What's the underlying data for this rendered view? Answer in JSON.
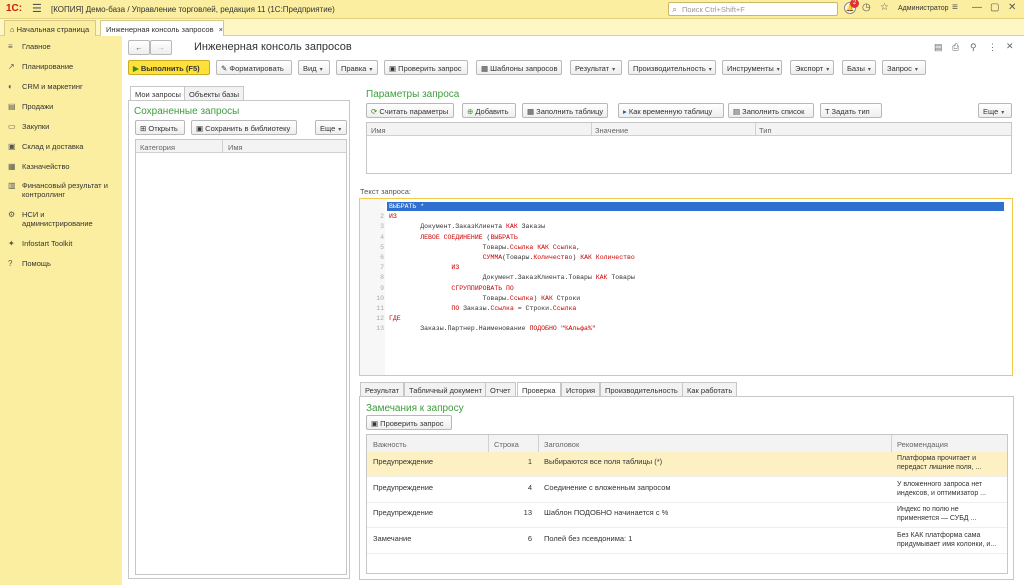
{
  "titlebar": {
    "logo": "1С:",
    "title": "[КОПИЯ] Демо-база / Управление торговлей, редакция 11  (1С:Предприятие)",
    "search_placeholder": "Поиск Ctrl+Shift+F",
    "notif_count": "2",
    "user": "Администратор"
  },
  "tabs": {
    "home": "Начальная страница",
    "console": "Инженерная консоль запросов",
    "close": "×"
  },
  "sidebar": [
    {
      "icon": "≡",
      "label": "Главное"
    },
    {
      "icon": "↗",
      "label": "Планирование"
    },
    {
      "icon": "◐",
      "label": "CRM и маркетинг"
    },
    {
      "icon": "▤",
      "label": "Продажи"
    },
    {
      "icon": "▭",
      "label": "Закупки"
    },
    {
      "icon": "▣",
      "label": "Склад и доставка"
    },
    {
      "icon": "▦",
      "label": "Казначейство"
    },
    {
      "icon": "▥",
      "label": "Финансовый результат и контроллинг"
    },
    {
      "icon": "⚙",
      "label": "НСИ и администрирование"
    },
    {
      "icon": "✦",
      "label": "Infostart Toolkit"
    },
    {
      "icon": "?",
      "label": "Помощь"
    }
  ],
  "page": {
    "title": "Инженерная консоль запросов",
    "back": "←",
    "forward": "→"
  },
  "toolbar": {
    "run": "Выполнить (F5)",
    "format": "Форматировать",
    "vid": "Вид",
    "edit": "Правка",
    "check": "Проверить запрос",
    "templates": "Шаблоны запросов",
    "result": "Результат",
    "perf": "Производительность",
    "tools": "Инструменты",
    "export": "Экспорт",
    "bases": "Базы",
    "query": "Запрос"
  },
  "left": {
    "tab1": "Мои запросы",
    "tab2": "Объекты базы",
    "heading": "Сохраненные запросы",
    "open": "Открыть",
    "save": "Сохранить в библиотеку",
    "more": "Еще",
    "col1": "Категория",
    "col2": "Имя"
  },
  "params": {
    "heading": "Параметры запроса",
    "read": "Считать параметры",
    "add": "Добавить",
    "fill": "Заполнить таблицу",
    "temp": "Как временную таблицу",
    "fill_list": "Заполнить список",
    "set_type": "Задать тип",
    "more": "Еще",
    "col_name": "Имя",
    "col_value": "Значение",
    "col_type": "Тип"
  },
  "editor": {
    "label": "Текст запроса:"
  },
  "code": [
    "ВЫБРАТЬ *",
    "ИЗ",
    "        Документ.ЗаказКлиента КАК Заказы",
    "        ЛЕВОЕ СОЕДИНЕНИЕ (ВЫБРАТЬ",
    "                        Товары.Ссылка КАК Ссылка,",
    "                        СУММА(Товары.Количество) КАК Количество",
    "                ИЗ",
    "                        Документ.ЗаказКлиента.Товары КАК Товары",
    "                СГРУППИРОВАТЬ ПО",
    "                        Товары.Ссылка) КАК Строки",
    "                ПО Заказы.Ссылка = Строки.Ссылка",
    "ГДЕ",
    "        Заказы.Партнер.Наименование ПОДОБНО \"%Альфа%\""
  ],
  "bottom_tabs": [
    "Результат",
    "Табличный документ",
    "Отчет",
    "Проверка",
    "История",
    "Производительность",
    "Как работать"
  ],
  "check": {
    "heading": "Замечания к запросу",
    "button": "Проверить запрос",
    "col_level": "Важность",
    "col_row": "Строка",
    "col_title": "Заголовок",
    "col_rec": "Рекомендация"
  },
  "check_rows": [
    {
      "level": "Предупреждение",
      "row": "1",
      "title": "Выбираются все поля таблицы (*)",
      "rec1": "Платформа прочитает и",
      "rec2": "передаст лишние поля, ..."
    },
    {
      "level": "Предупреждение",
      "row": "4",
      "title": "Соединение с вложенным запросом",
      "rec1": "У вложенного запроса нет",
      "rec2": "индексов, и оптимизатор ..."
    },
    {
      "level": "Предупреждение",
      "row": "13",
      "title": "Шаблон ПОДОБНО начинается с %",
      "rec1": "Индекс по полю не",
      "rec2": "применяется — СУБД ..."
    },
    {
      "level": "Замечание",
      "row": "6",
      "title": "Полей без псевдонима: 1",
      "rec1": "Без КАК платформа сама",
      "rec2": "придумывает имя колонки, и..."
    }
  ]
}
